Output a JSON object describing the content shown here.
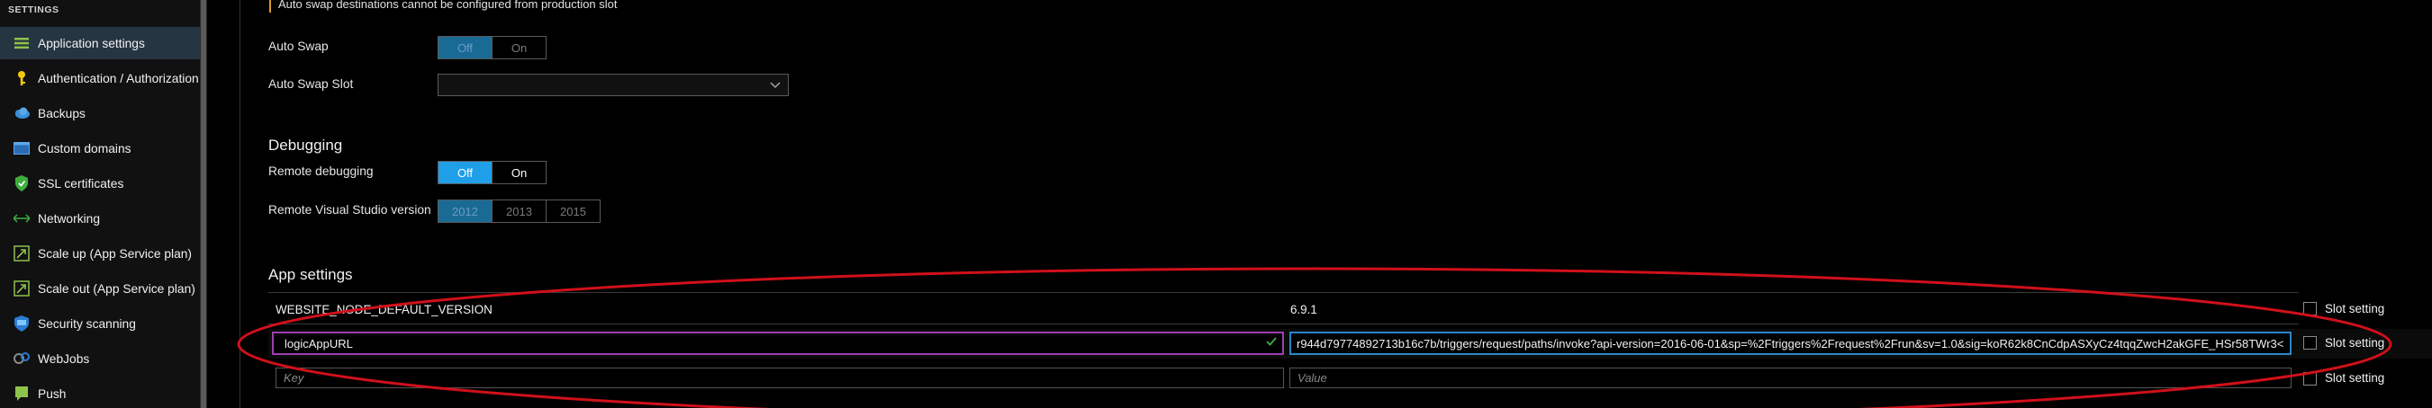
{
  "sidebar": {
    "section_title": "SETTINGS",
    "items": [
      {
        "label": "Application settings",
        "icon": "list-icon",
        "active": true
      },
      {
        "label": "Authentication / Authorization",
        "icon": "key-icon"
      },
      {
        "label": "Backups",
        "icon": "cloud-icon"
      },
      {
        "label": "Custom domains",
        "icon": "window-icon"
      },
      {
        "label": "SSL certificates",
        "icon": "shield-icon"
      },
      {
        "label": "Networking",
        "icon": "network-icon"
      },
      {
        "label": "Scale up (App Service plan)",
        "icon": "scale-up-icon"
      },
      {
        "label": "Scale out (App Service plan)",
        "icon": "scale-out-icon"
      },
      {
        "label": "Security scanning",
        "icon": "security-scan-icon"
      },
      {
        "label": "WebJobs",
        "icon": "webjobs-icon"
      },
      {
        "label": "Push",
        "icon": "push-icon"
      }
    ]
  },
  "main": {
    "note": "Auto swap destinations cannot be configured from production slot",
    "auto_swap": {
      "label": "Auto Swap",
      "options": [
        "Off",
        "On"
      ],
      "selected": "Off"
    },
    "auto_swap_slot": {
      "label": "Auto Swap Slot",
      "value": ""
    },
    "debugging": {
      "heading": "Debugging",
      "remote_debugging": {
        "label": "Remote debugging",
        "options": [
          "Off",
          "On"
        ],
        "selected": "Off"
      },
      "vs_version": {
        "label": "Remote Visual Studio version",
        "options": [
          "2012",
          "2013",
          "2015"
        ],
        "selected": "2012"
      }
    },
    "app_settings": {
      "heading": "App settings",
      "rows": [
        {
          "key": "WEBSITE_NODE_DEFAULT_VERSION",
          "value": "6.9.1",
          "slot_setting": "Slot setting"
        },
        {
          "key": "logicAppURL",
          "value": "r944d79774892713b16c7b/triggers/request/paths/invoke?api-version=2016-06-01&sp=%2Ftriggers%2Frequest%2Frun&sv=1.0&sig=koR62k8CnCdpASXyCz4tqqZwcH2akGFE_HSr58TWr3<",
          "slot_setting": "Slot setting"
        }
      ],
      "new_row": {
        "key_placeholder": "Key",
        "value_placeholder": "Value",
        "slot_setting": "Slot setting"
      }
    },
    "highlight_color": "#d0101a"
  }
}
